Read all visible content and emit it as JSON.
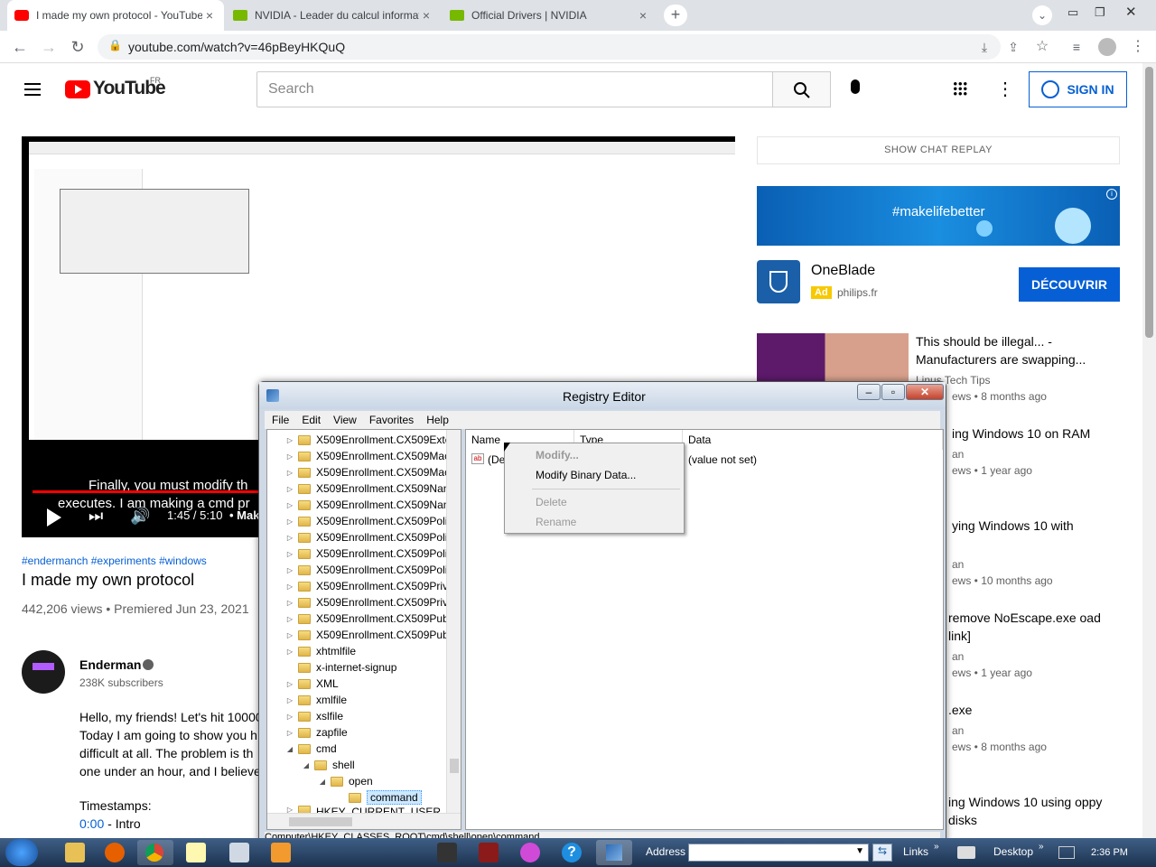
{
  "browser": {
    "tabs": [
      {
        "title": "I made my own protocol - YouTube",
        "close": "×"
      },
      {
        "title": "NVIDIA - Leader du calcul informatique",
        "close": "×"
      },
      {
        "title": "Official Drivers | NVIDIA",
        "close": "×"
      }
    ],
    "new_tab": "+",
    "url": "youtube.com/watch?v=46pBeyHKQuQ"
  },
  "youtube": {
    "logo": "YouTube",
    "region": "FR",
    "search_placeholder": "Search",
    "sign_in": "SIGN IN",
    "player": {
      "caption1": "Finally, you must modify th",
      "caption2": "executes. I am making a cmd pr",
      "time": "1:45 / 5:10",
      "chapter": "• Mak"
    },
    "hashtags": "#endermanch #experiments #windows",
    "title": "I made my own protocol",
    "views": "442,206 views • Premiered Jun 23, 2021",
    "channel": {
      "name": "Enderman",
      "subs": "238K subscribers"
    },
    "description": [
      "Hello, my friends! Let's hit 10000",
      "Today I am going to show you h",
      "difficult at all. The problem is th",
      "one under an hour, and I believe"
    ],
    "timestamps_label": "Timestamps:",
    "timestamp1": {
      "time": "0:00",
      "label": " - Intro"
    },
    "chat_replay": "SHOW CHAT REPLAY",
    "ad": {
      "banner": "#makelifebetter",
      "name": "OneBlade",
      "badge": "Ad",
      "domain": "philips.fr",
      "cta": "DÉCOUVRIR"
    },
    "recs": [
      {
        "title": "This should be illegal... - Manufacturers are swapping...",
        "channel": "Linus Tech Tips",
        "meta": "ews • 8 months ago"
      },
      {
        "title": "ing Windows 10 on RAM",
        "channel": "an",
        "meta": "ews • 1 year ago"
      },
      {
        "title": "ying Windows 10 with",
        "channel": "an",
        "meta": "ews • 10 months ago"
      },
      {
        "title": "remove NoEscape.exe oad link]",
        "channel": "an",
        "meta": "ews • 1 year ago"
      },
      {
        "title": ".exe",
        "channel": "an",
        "meta": "ews • 8 months ago"
      },
      {
        "title": "ing Windows 10 using oppy disks",
        "channel": "",
        "meta": ""
      }
    ]
  },
  "regedit": {
    "title": "Registry Editor",
    "menu": [
      "File",
      "Edit",
      "View",
      "Favorites",
      "Help"
    ],
    "tree": [
      "X509Enrollment.CX509Exte",
      "X509Enrollment.CX509Mac",
      "X509Enrollment.CX509Mac",
      "X509Enrollment.CX509Nan",
      "X509Enrollment.CX509Nan",
      "X509Enrollment.CX509Poli",
      "X509Enrollment.CX509Poli",
      "X509Enrollment.CX509Poli",
      "X509Enrollment.CX509Poli",
      "X509Enrollment.CX509Priv",
      "X509Enrollment.CX509Priv",
      "X509Enrollment.CX509Pub",
      "X509Enrollment.CX509Pub",
      "xhtmlfile",
      "x-internet-signup",
      "XML",
      "xmlfile",
      "xslfile",
      "zapfile",
      "cmd",
      "shell",
      "open",
      "command",
      "HKEY_CURRENT_USER"
    ],
    "columns": {
      "name": "Name",
      "type": "Type",
      "data": "Data"
    },
    "value": {
      "name": "(Def",
      "data": "(value not set)"
    },
    "context_menu": [
      "Modify...",
      "Modify Binary Data...",
      "Delete",
      "Rename"
    ],
    "status": "Computer\\HKEY_CLASSES_ROOT\\cmd\\shell\\open\\command"
  },
  "taskbar": {
    "address_label": "Address",
    "links": "Links",
    "desktop": "Desktop",
    "clock": "2:36 PM"
  }
}
